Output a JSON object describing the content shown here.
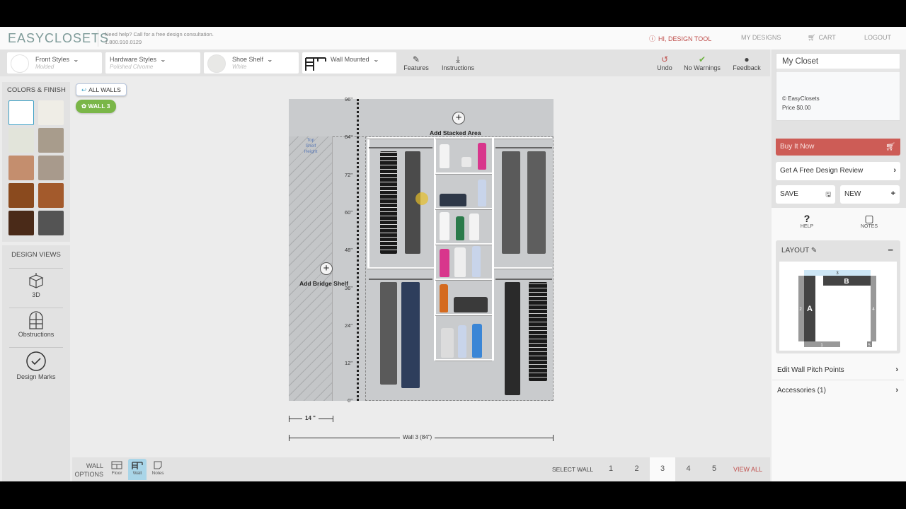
{
  "header": {
    "logo": "EASYCLOSETS",
    "help_line1": "Need help? Call for a free design consultation.",
    "help_line2": "1.800.910.0129",
    "nav": [
      {
        "label": "HI, DESIGN TOOL",
        "icon": "user-icon"
      },
      {
        "label": "MY DESIGNS"
      },
      {
        "label": "CART",
        "icon": "cart-icon"
      },
      {
        "label": "LOGOUT"
      }
    ]
  },
  "toolbar": {
    "dropdowns": [
      {
        "title": "Front Styles",
        "value": "Molded"
      },
      {
        "title": "Hardware Styles",
        "value": "Polished Chrome"
      },
      {
        "title": "Shoe Shelf",
        "value": "White"
      },
      {
        "title": "Wall Mounted",
        "value": ""
      }
    ],
    "actions": [
      {
        "label": "Features",
        "icon": "pencil-icon"
      },
      {
        "label": "Instructions",
        "icon": "download-icon"
      },
      {
        "label": "Undo",
        "icon": "undo-icon"
      },
      {
        "label": "No Warnings",
        "icon": "check-icon"
      },
      {
        "label": "Feedback",
        "icon": "comment-icon"
      }
    ]
  },
  "left_panel": {
    "colors_title": "COLORS & FINISH",
    "swatches": [
      "#ffffff",
      "#efede6",
      "#e2e4da",
      "#a89c8c",
      "#c48e6e",
      "#a89a8c",
      "#8a4a1e",
      "#a35a2c",
      "#4a2a18",
      "#545454"
    ],
    "selected_swatch": 0,
    "views_title": "DESIGN VIEWS",
    "views": [
      {
        "label": "3D",
        "icon": "cube-icon"
      },
      {
        "label": "Obstructions",
        "icon": "window-icon"
      },
      {
        "label": "Design Marks",
        "icon": "check-circle-icon"
      }
    ]
  },
  "chips": {
    "all_walls": "ALL WALLS",
    "wall": "WALL 3"
  },
  "canvas": {
    "ruler_labels": [
      "96\"",
      "84\"",
      "72\"",
      "60\"",
      "48\"",
      "36\"",
      "24\"",
      "12\"",
      "0\""
    ],
    "top_shelf_label": "Top Shelf Height",
    "add_stacked": "Add Stacked Area",
    "add_bridge": "Add Bridge Shelf",
    "depth_dim": "14 \"",
    "wall_dim": "Wall 3 (84\")"
  },
  "right_panel": {
    "closet_name": "My Closet",
    "copyright": "© EasyClosets",
    "price": "Price $0.00",
    "buy": "Buy It Now",
    "review": "Get A Free Design Review",
    "save": "SAVE",
    "new": "NEW",
    "help": "HELP",
    "notes": "NOTES",
    "layout_title": "LAYOUT",
    "layout_labels": {
      "a": "A",
      "b": "B",
      "w1": "1",
      "w2": "2",
      "w3": "3",
      "w4": "4",
      "w5": "5"
    },
    "edit_pitch": "Edit Wall Pitch Points",
    "accessories": "Accessories (1)"
  },
  "bottom_bar": {
    "wall_options": "WALL OPTIONS",
    "tabs": [
      {
        "label": "Floor"
      },
      {
        "label": "Wall"
      },
      {
        "label": "Notes"
      }
    ],
    "active_tab": 1,
    "select_wall": "SELECT WALL",
    "walls": [
      "1",
      "2",
      "3",
      "4",
      "5"
    ],
    "active_wall": "3",
    "view_all": "VIEW ALL"
  }
}
